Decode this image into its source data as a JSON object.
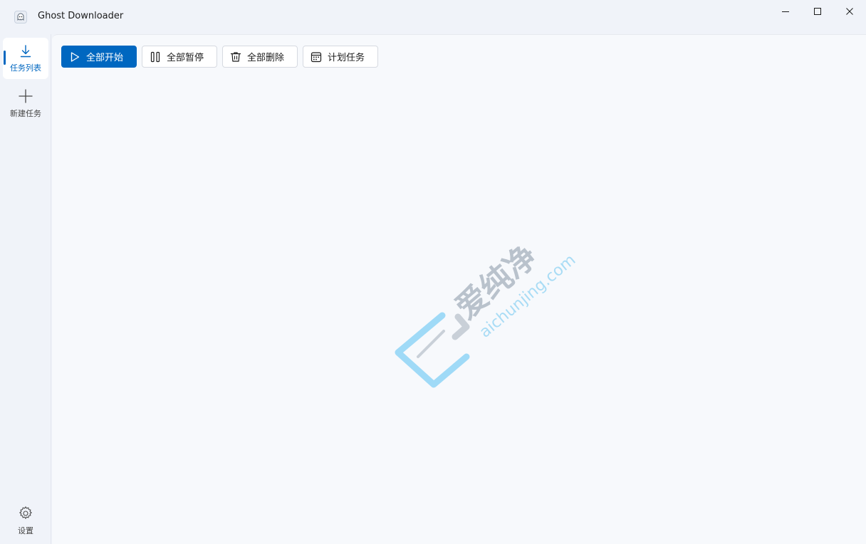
{
  "window": {
    "title": "Ghost Downloader",
    "controls": {
      "minimize": "minimize-icon",
      "maximize": "maximize-icon",
      "close": "close-icon"
    }
  },
  "sidebar": {
    "items": [
      {
        "label": "任务列表",
        "icon": "download-icon",
        "active": true
      },
      {
        "label": "新建任务",
        "icon": "plus-icon",
        "active": false
      }
    ],
    "footer": {
      "label": "设置",
      "icon": "gear-icon"
    }
  },
  "toolbar": {
    "start_all": "全部开始",
    "pause_all": "全部暂停",
    "delete_all": "全部删除",
    "schedule": "计划任务"
  },
  "watermark": {
    "brand": "爱纯净",
    "domain": "aichunjing.com"
  },
  "colors": {
    "accent": "#0067c0",
    "background": "#f0f3f9",
    "content": "#f7f9fc",
    "watermark_blue": "#8fd3f5",
    "watermark_gray": "#c4ccd5"
  }
}
